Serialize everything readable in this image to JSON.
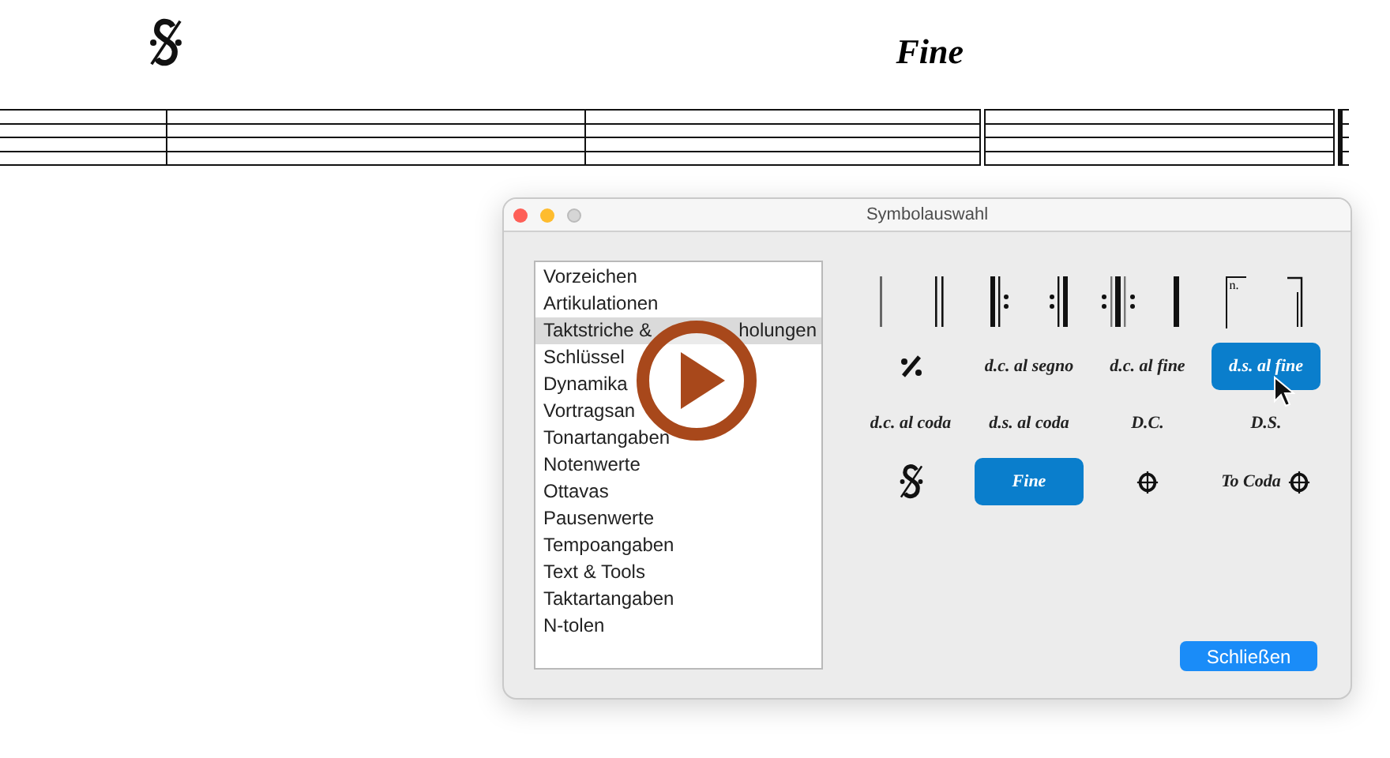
{
  "score": {
    "measures": [
      {
        "kind": "single"
      },
      {
        "kind": "single",
        "marking": {
          "kind": "segno"
        }
      },
      {
        "kind": "double",
        "marking": {
          "kind": "text",
          "label": "Fine"
        }
      },
      {
        "kind": "final"
      }
    ]
  },
  "dialog": {
    "title": "Symbolauswahl",
    "categories": [
      {
        "label": "Vorzeichen",
        "selected": false
      },
      {
        "label": "Artikulationen",
        "selected": false
      },
      {
        "label": "Taktstriche &",
        "tail": "holungen",
        "selected": true
      },
      {
        "label": "Schlüssel",
        "selected": false
      },
      {
        "label": "Dynamika",
        "selected": false
      },
      {
        "label": "Vortragsan",
        "selected": false
      },
      {
        "label": "Tonartangaben",
        "selected": false
      },
      {
        "label": "Notenwerte",
        "selected": false
      },
      {
        "label": "Ottavas",
        "selected": false
      },
      {
        "label": "Pausenwerte",
        "selected": false
      },
      {
        "label": "Tempoangaben",
        "selected": false
      },
      {
        "label": "Text & Tools",
        "selected": false
      },
      {
        "label": "Taktartangaben",
        "selected": false
      },
      {
        "label": "N-tolen",
        "selected": false
      }
    ],
    "symbols": [
      {
        "kind": "single-bar",
        "selected": false
      },
      {
        "kind": "double-bar",
        "selected": false
      },
      {
        "kind": "repeat-start",
        "selected": false
      },
      {
        "kind": "repeat-end",
        "selected": false
      },
      {
        "kind": "repeat-both",
        "selected": false
      },
      {
        "kind": "thick-bar",
        "selected": false
      },
      {
        "kind": "volta-start",
        "label": "n.",
        "selected": false
      },
      {
        "kind": "volta-end",
        "selected": false
      },
      {
        "kind": "percent-repeat",
        "selected": false
      },
      {
        "kind": "text",
        "label": "d.c. al segno",
        "selected": false
      },
      {
        "kind": "text",
        "label": "d.c. al fine",
        "selected": false
      },
      {
        "kind": "text",
        "label": "d.s. al fine",
        "selected": true
      },
      {
        "kind": "text",
        "label": "d.c. al coda",
        "selected": false
      },
      {
        "kind": "text",
        "label": "d.s. al coda",
        "selected": false
      },
      {
        "kind": "text",
        "label": "D.C.",
        "selected": false
      },
      {
        "kind": "text",
        "label": "D.S.",
        "selected": false
      },
      {
        "kind": "segno",
        "selected": false
      },
      {
        "kind": "text",
        "label": "Fine",
        "selected": true
      },
      {
        "kind": "coda",
        "selected": false
      },
      {
        "kind": "text-coda",
        "label": "To Coda",
        "selected": false
      }
    ],
    "close_button": "Schließen"
  }
}
